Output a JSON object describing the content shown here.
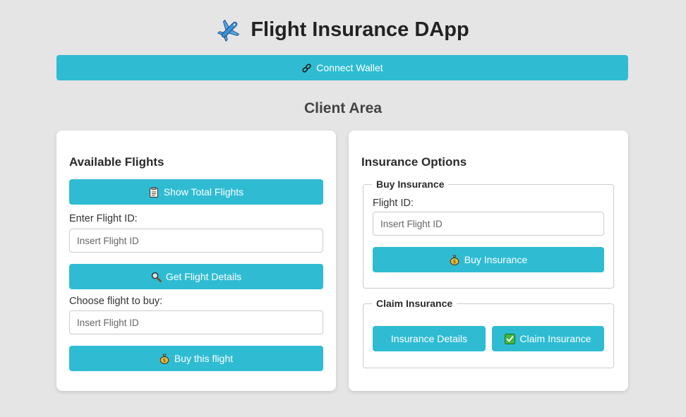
{
  "header": {
    "title": "Flight Insurance DApp",
    "icon": "airplane-icon"
  },
  "wallet": {
    "connect_label": "Connect Wallet",
    "icon": "link-icon"
  },
  "client_area": {
    "title": "Client Area"
  },
  "flights_card": {
    "title": "Available Flights",
    "show_total_label": "Show Total Flights",
    "flight_id_label": "Enter Flight ID:",
    "flight_id_placeholder": "Insert Flight ID",
    "get_details_label": "Get Flight Details",
    "choose_label": "Choose flight to buy:",
    "choose_placeholder": "Insert Flight ID",
    "buy_flight_label": "Buy this flight"
  },
  "insurance_card": {
    "title": "Insurance Options",
    "buy_section": {
      "legend": "Buy Insurance",
      "flight_id_label": "Flight ID:",
      "flight_id_placeholder": "Insert Flight ID",
      "buy_label": "Buy Insurance"
    },
    "claim_section": {
      "legend": "Claim Insurance",
      "details_label": "Insurance Details",
      "claim_label": "Claim Insurance"
    }
  },
  "colors": {
    "accent": "#2fbcd3",
    "background": "#e5e5e5",
    "card": "#ffffff"
  }
}
